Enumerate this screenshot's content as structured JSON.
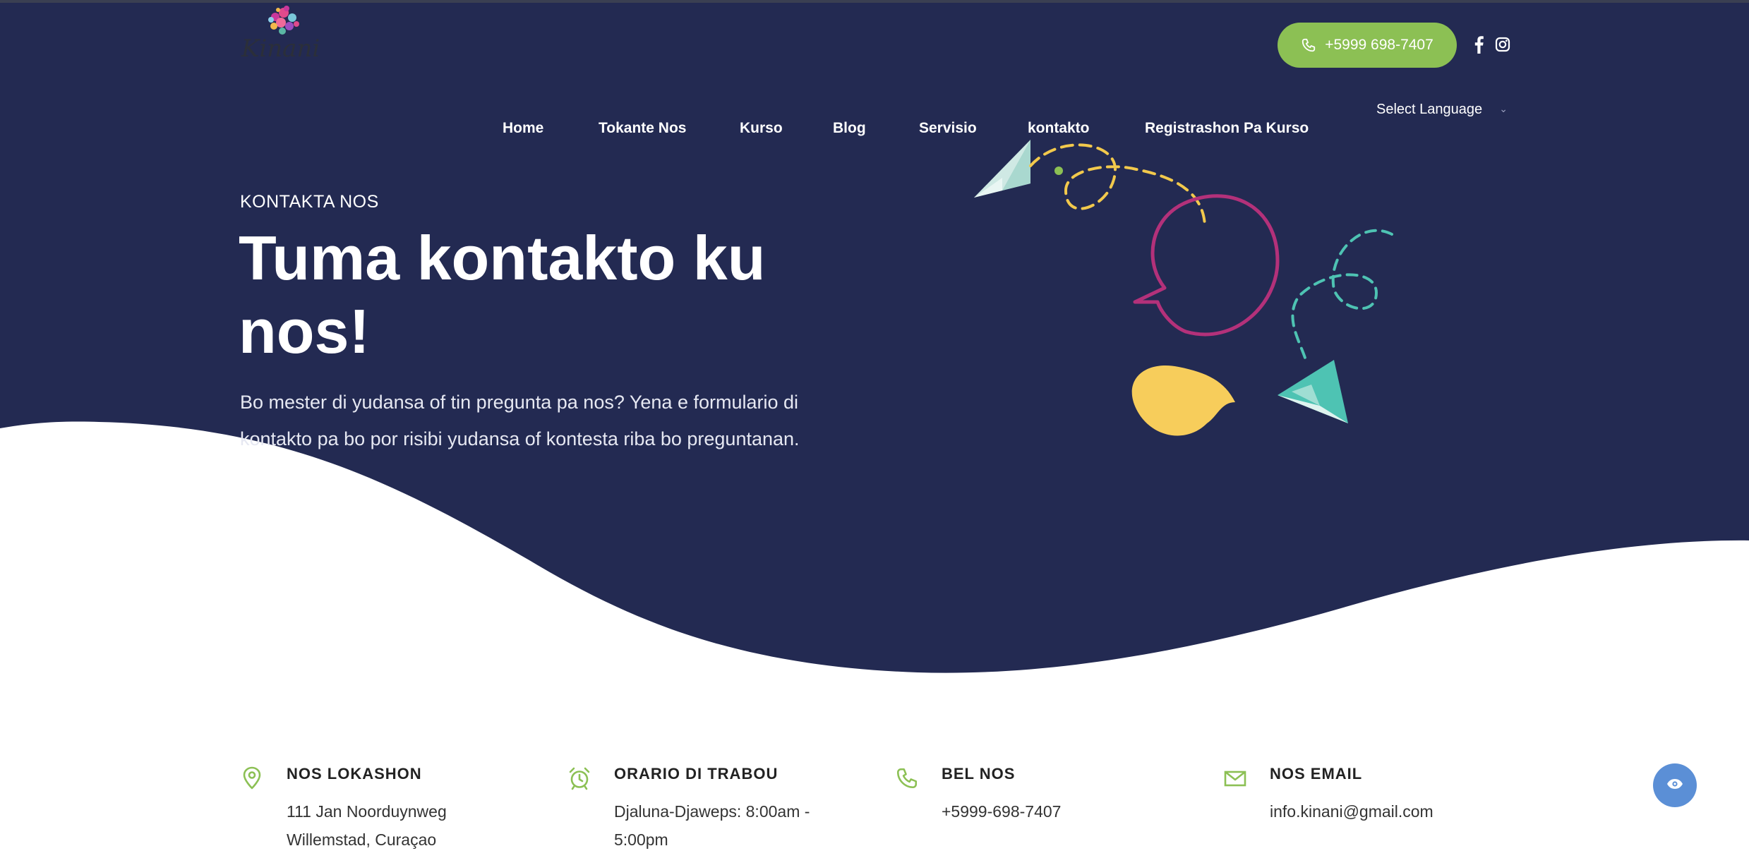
{
  "colors": {
    "hero_bg": "#232a52",
    "accent_green": "#8cc054",
    "white": "#ffffff",
    "eye_button": "#5b8fd6"
  },
  "header": {
    "logo_text": "Kinani",
    "phone_label": "+5999 698-7407",
    "social": {
      "facebook_icon": "facebook-icon",
      "instagram_icon": "instagram-icon"
    },
    "language_select": "Select Language"
  },
  "nav": {
    "items": [
      {
        "label": "Home"
      },
      {
        "label": "Tokante Nos"
      },
      {
        "label": "Kurso"
      },
      {
        "label": "Blog"
      },
      {
        "label": "Servisio"
      },
      {
        "label": "kontakto"
      },
      {
        "label": "Registrashon Pa Kurso"
      }
    ]
  },
  "hero": {
    "eyebrow": "KONTAKTA NOS",
    "title": "Tuma kontakto ku nos!",
    "intro": "Bo mester di yudansa of tin pregunta pa nos? Yena e formulario di kontakto pa bo por risibi yudansa of kontesta riba bo preguntanan."
  },
  "contact_info": [
    {
      "icon": "location-pin-icon",
      "heading": "NOS LOKASHON",
      "line1": "111 Jan Noorduynweg",
      "line2": "Willemstad, Curaçao"
    },
    {
      "icon": "alarm-clock-icon",
      "heading": "ORARIO DI TRABOU",
      "line1": "Djaluna-Djaweps: 8:00am -",
      "line2": "5:00pm"
    },
    {
      "icon": "phone-icon",
      "heading": "BEL NOS",
      "line1": "+5999-698-7407",
      "line2": ""
    },
    {
      "icon": "email-icon",
      "heading": "NOS EMAIL",
      "line1": "info.kinani@gmail.com",
      "line2": ""
    }
  ],
  "floating": {
    "accessibility_icon": "eye-icon"
  }
}
